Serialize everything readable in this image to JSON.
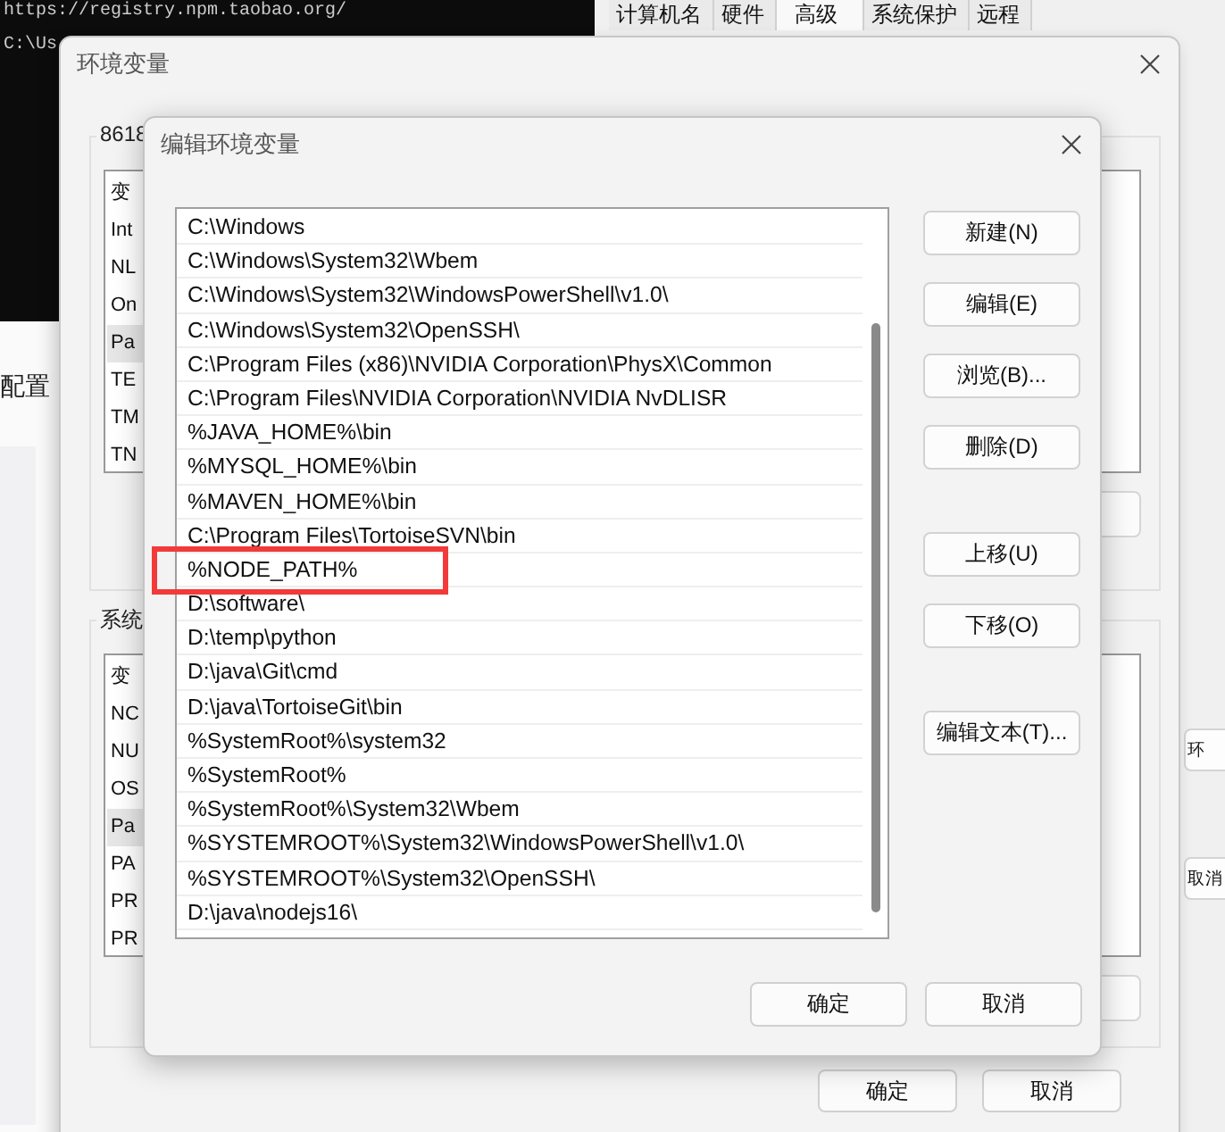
{
  "terminal": {
    "lines": [
      "https://registry.npm.taobao.org/",
      "C:\\Us"
    ]
  },
  "background_page": {
    "text": "配置"
  },
  "system_properties": {
    "tabs": [
      {
        "label": "计算机名",
        "selected": false
      },
      {
        "label": "硬件",
        "selected": false
      },
      {
        "label": "高级",
        "selected": true
      },
      {
        "label": "系统保护",
        "selected": false
      },
      {
        "label": "远程",
        "selected": false
      }
    ],
    "buttons": [
      "环",
      "取消"
    ]
  },
  "env_window": {
    "title": "环境变量",
    "user_group": {
      "label": "8618",
      "items": [
        {
          "text": "变",
          "selected": false
        },
        {
          "text": "Int",
          "selected": false
        },
        {
          "text": "NL",
          "selected": false
        },
        {
          "text": "On",
          "selected": false
        },
        {
          "text": "Pa",
          "selected": true
        },
        {
          "text": "TE",
          "selected": false
        },
        {
          "text": "TM",
          "selected": false
        },
        {
          "text": "TN",
          "selected": false
        }
      ]
    },
    "system_group": {
      "label": "系统",
      "items": [
        {
          "text": "变",
          "selected": false
        },
        {
          "text": "NC",
          "selected": false
        },
        {
          "text": "NU",
          "selected": false
        },
        {
          "text": "OS",
          "selected": false
        },
        {
          "text": "Pa",
          "selected": true
        },
        {
          "text": "PA",
          "selected": false
        },
        {
          "text": "PR",
          "selected": false
        },
        {
          "text": "PR",
          "selected": false
        }
      ]
    },
    "buttons": [
      "确定",
      "取消"
    ]
  },
  "edit_window": {
    "title": "编辑环境变量",
    "paths": [
      {
        "text": "C:\\Windows",
        "highlighted": false
      },
      {
        "text": "C:\\Windows\\System32\\Wbem",
        "highlighted": false
      },
      {
        "text": "C:\\Windows\\System32\\WindowsPowerShell\\v1.0\\",
        "highlighted": false
      },
      {
        "text": "C:\\Windows\\System32\\OpenSSH\\",
        "highlighted": false
      },
      {
        "text": "C:\\Program Files (x86)\\NVIDIA Corporation\\PhysX\\Common",
        "highlighted": false
      },
      {
        "text": "C:\\Program Files\\NVIDIA Corporation\\NVIDIA NvDLISR",
        "highlighted": false
      },
      {
        "text": "%JAVA_HOME%\\bin",
        "highlighted": false
      },
      {
        "text": "%MYSQL_HOME%\\bin",
        "highlighted": false
      },
      {
        "text": "%MAVEN_HOME%\\bin",
        "highlighted": false
      },
      {
        "text": "C:\\Program Files\\TortoiseSVN\\bin",
        "highlighted": false
      },
      {
        "text": "%NODE_PATH%",
        "highlighted": true
      },
      {
        "text": "D:\\software\\",
        "highlighted": false
      },
      {
        "text": "D:\\temp\\python",
        "highlighted": false
      },
      {
        "text": "D:\\java\\Git\\cmd",
        "highlighted": false
      },
      {
        "text": "D:\\java\\TortoiseGit\\bin",
        "highlighted": false
      },
      {
        "text": "%SystemRoot%\\system32",
        "highlighted": false
      },
      {
        "text": "%SystemRoot%",
        "highlighted": false
      },
      {
        "text": "%SystemRoot%\\System32\\Wbem",
        "highlighted": false
      },
      {
        "text": "%SYSTEMROOT%\\System32\\WindowsPowerShell\\v1.0\\",
        "highlighted": false
      },
      {
        "text": "%SYSTEMROOT%\\System32\\OpenSSH\\",
        "highlighted": false
      },
      {
        "text": "D:\\java\\nodejs16\\",
        "highlighted": false
      }
    ],
    "side_buttons": [
      {
        "label": "新建(N)",
        "kind": "group1"
      },
      {
        "label": "编辑(E)",
        "kind": "group1"
      },
      {
        "label": "浏览(B)...",
        "kind": "group1"
      },
      {
        "label": "删除(D)",
        "kind": "group1"
      },
      {
        "label": "上移(U)",
        "kind": "group2"
      },
      {
        "label": "下移(O)",
        "kind": "group2"
      },
      {
        "label": "编辑文本(T)...",
        "kind": "group3"
      }
    ],
    "footer_buttons": [
      "确定",
      "取消"
    ]
  }
}
